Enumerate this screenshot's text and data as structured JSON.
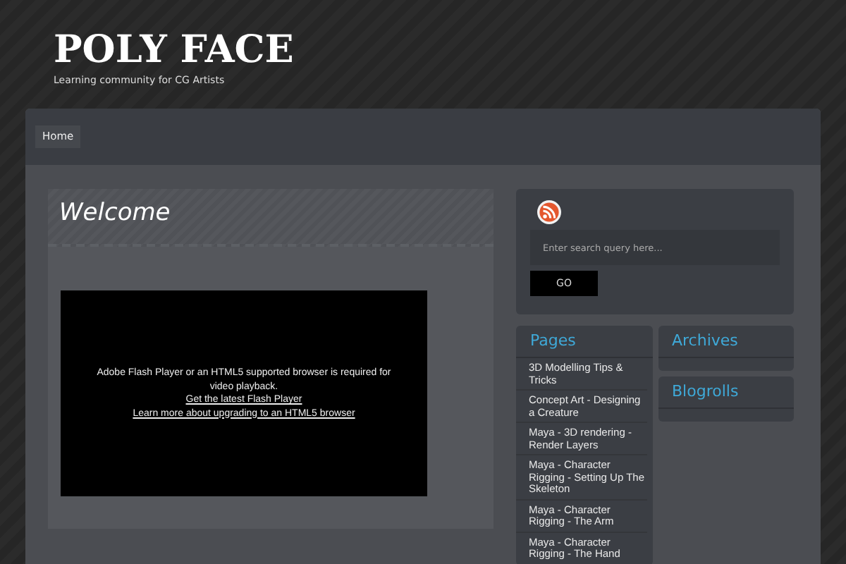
{
  "site": {
    "title": "POLY FACE",
    "tagline": "Learning community for CG Artists"
  },
  "nav": [
    {
      "label": "Home"
    }
  ],
  "post": {
    "title": "Welcome",
    "video": {
      "message": "Adobe Flash Player or an HTML5 supported browser is required for video playback.",
      "links": [
        "Get the latest Flash Player",
        "Learn more about upgrading to an HTML5 browser"
      ]
    }
  },
  "search": {
    "placeholder": "Enter search query here...",
    "button": "GO"
  },
  "pages": {
    "title": "Pages",
    "items": [
      "3D Modelling Tips & Tricks",
      "Concept Art - Designing a Creature",
      "Maya - 3D rendering - Render Layers",
      "Maya - Character Rigging - Setting Up The Skeleton",
      "Maya - Character Rigging - The Arm",
      "Maya - Character Rigging - The Hand"
    ]
  },
  "widgets": [
    {
      "title": "Archives"
    },
    {
      "title": "Blogrolls"
    }
  ]
}
